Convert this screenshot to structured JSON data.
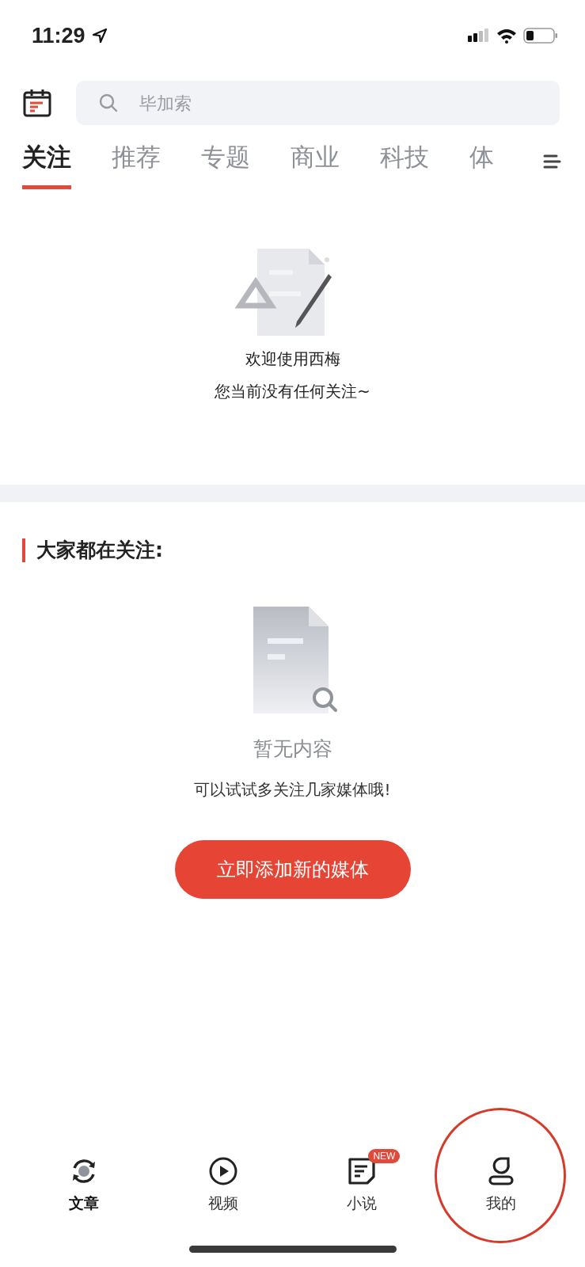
{
  "status_bar": {
    "time": "11:29"
  },
  "search": {
    "placeholder": "毕加索"
  },
  "tabs": [
    {
      "label": "关注",
      "selected": true
    },
    {
      "label": "推荐",
      "selected": false
    },
    {
      "label": "专题",
      "selected": false
    },
    {
      "label": "商业",
      "selected": false
    },
    {
      "label": "科技",
      "selected": false
    },
    {
      "label": "体",
      "selected": false
    }
  ],
  "welcome": {
    "title": "欢迎使用西梅",
    "subtitle": "您当前没有任何关注~"
  },
  "section": {
    "heading": "大家都在关注:",
    "empty_title": "暂无内容",
    "empty_hint": "可以试试多关注几家媒体哦!",
    "button": "立即添加新的媒体"
  },
  "bottom_nav": [
    {
      "label": "文章",
      "kind": "article",
      "selected": true
    },
    {
      "label": "视频",
      "kind": "video",
      "selected": false
    },
    {
      "label": "小说",
      "kind": "novel",
      "selected": false,
      "badge": "NEW"
    },
    {
      "label": "我的",
      "kind": "profile",
      "selected": false,
      "circled": true
    }
  ]
}
